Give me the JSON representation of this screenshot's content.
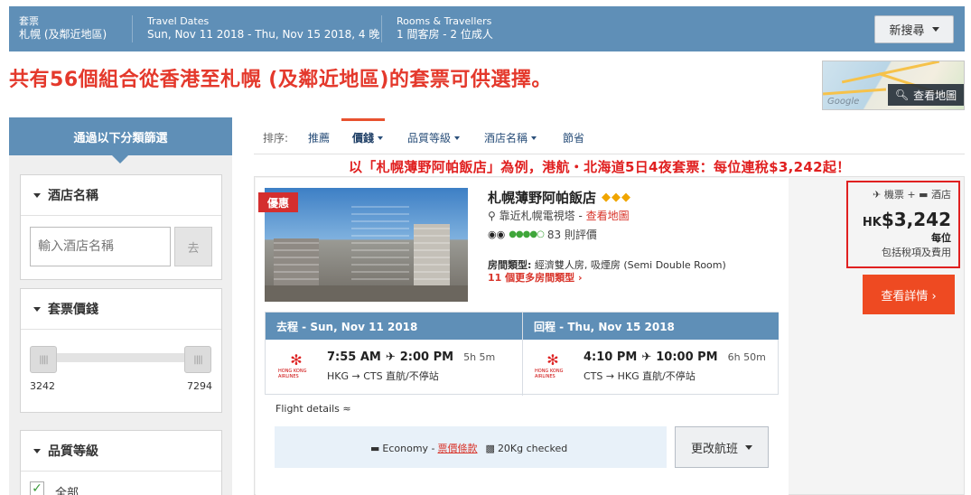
{
  "topbar": {
    "package_label": "套票",
    "package_value": "札幌 (及鄰近地區)",
    "dates_label": "Travel Dates",
    "dates_value": "Sun, Nov 11 2018 - Thu, Nov 15 2018, 4 晚",
    "rooms_label": "Rooms & Travellers",
    "rooms_value": "1 間客房 - 2 位成人",
    "new_search": "新搜尋"
  },
  "headline": {
    "prefix": "共有",
    "count": "56",
    "suffix": "個組合從香港至札幌 (及鄰近地區)的套票可供選擇。"
  },
  "map": {
    "label": "查看地圖",
    "google": "Google"
  },
  "filters": {
    "header": "通過以下分類篩選",
    "hotel_name_title": "酒店名稱",
    "hotel_name_placeholder": "輸入酒店名稱",
    "hotel_name_go": "去",
    "price_title": "套票價錢",
    "price_min": "3242",
    "price_max": "7294",
    "quality_title": "品質等級",
    "quality_all": "全部",
    "quality_all_checked": true
  },
  "sort": {
    "label": "排序:",
    "tabs": [
      {
        "label": "推薦"
      },
      {
        "label": "價錢"
      },
      {
        "label": "品質等級"
      },
      {
        "label": "酒店名稱"
      },
      {
        "label": "節省"
      }
    ],
    "active_tab": "價錢"
  },
  "promo_text": "以「札幌薄野阿帕飯店」為例，港航・北海道5日4夜套票：每位連稅$3,242起！",
  "result": {
    "badge": "優惠",
    "hotel_name": "札幌薄野阿帕飯店",
    "stars": "◆◆◆",
    "location": "靠近札幌電視塔 - ",
    "map_link": "查看地圖",
    "reviews": "83 則評價",
    "rating_dots": "●●●●○",
    "room_type_label": "房間類型:",
    "room_type_value": " 經濟雙人房, 吸煙房 (Semi Double Room)",
    "more_rooms": "11 個更多房間類型 ›",
    "outbound": {
      "header": "去程 - Sun, Nov 11 2018",
      "depart": "7:55 AM",
      "arrive": "2:00 PM",
      "duration": "5h 5m",
      "route": "HKG → CTS   直航/不停站",
      "airline": "HONG KONG AIRLINES"
    },
    "return": {
      "header": "回程 - Thu, Nov 15 2018",
      "depart": "4:10 PM",
      "arrive": "10:00 PM",
      "duration": "6h 50m",
      "route": "CTS → HKG   直航/不停站",
      "airline": "HONG KONG AIRLINES"
    },
    "flight_details": "Flight details ≈",
    "cabin": "Economy - ",
    "fare_rules": "票價條款",
    "baggage": "20Kg checked",
    "change_flight": "更改航班",
    "package_type": "✈ 機票 + ▬ 酒店",
    "currency": "HK",
    "price": "$3,242",
    "per": "每位",
    "includes": "包括稅項及費用",
    "view_details": "查看詳情 ›"
  },
  "colors": {
    "brand_blue": "#5f8fb7",
    "accent_orange": "#ee4a22",
    "headline_red": "#e4392c"
  }
}
